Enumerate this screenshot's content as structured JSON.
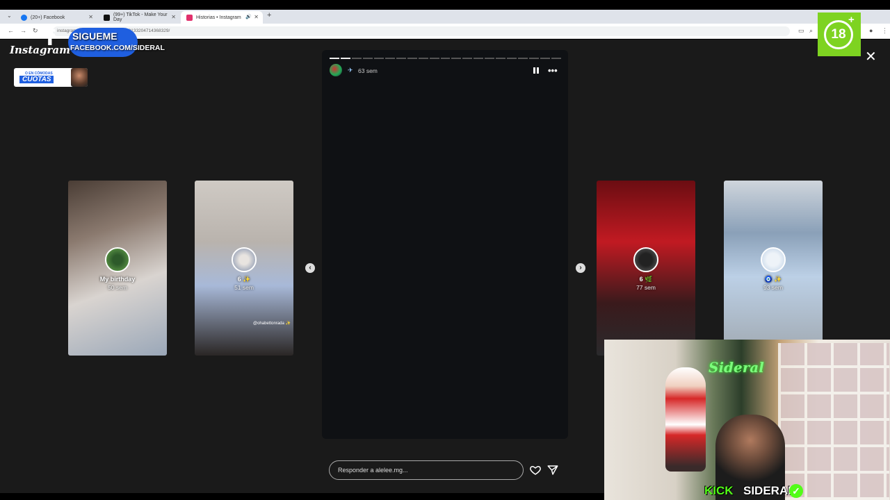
{
  "browser": {
    "tabs": [
      {
        "label": "(20+) Facebook",
        "icon": "facebook-icon",
        "color": "#1877f2"
      },
      {
        "label": "(99+) TikTok - Make Your Day",
        "icon": "tiktok-icon",
        "color": "#000000"
      },
      {
        "label": "Historias • Instagram",
        "icon": "instagram-icon",
        "color": "#e1306c"
      }
    ],
    "new_tab": "+",
    "url": "instagram.com/stories/alelee.mg/3181332047143​68329/"
  },
  "instagram": {
    "logo": "Instagram",
    "close": "✕",
    "story": {
      "time": "63 sem",
      "progress_total": 21,
      "progress_done": 2,
      "reply_placeholder": "Responder a alelee.mg..."
    },
    "side_stories": [
      {
        "name": "My birthday",
        "time": "50 sem"
      },
      {
        "name": "6 ✨",
        "time": "51 sem",
        "tag": "@ohabettonrada ✨"
      },
      {
        "name": "6 🌿",
        "time": "77 sem"
      },
      {
        "name": "🧿 ✨",
        "time": "93 sem"
      }
    ]
  },
  "overlays": {
    "follow_title": "SIGUEME",
    "follow_url": "FACEBOOK.COM/SIDERAL",
    "cuotas_small": "O EN CÓMODAS",
    "cuotas_big": "CUOTAS",
    "age_rating": "18",
    "age_plus": "+",
    "stream_platform": "KICK",
    "stream_name": "SIDERAL",
    "webcam_sign": "Sideral"
  },
  "colors": {
    "accent_kick": "#53fc18",
    "age_badge": "#7ed321",
    "facebook_blue": "#1f5fe0"
  }
}
